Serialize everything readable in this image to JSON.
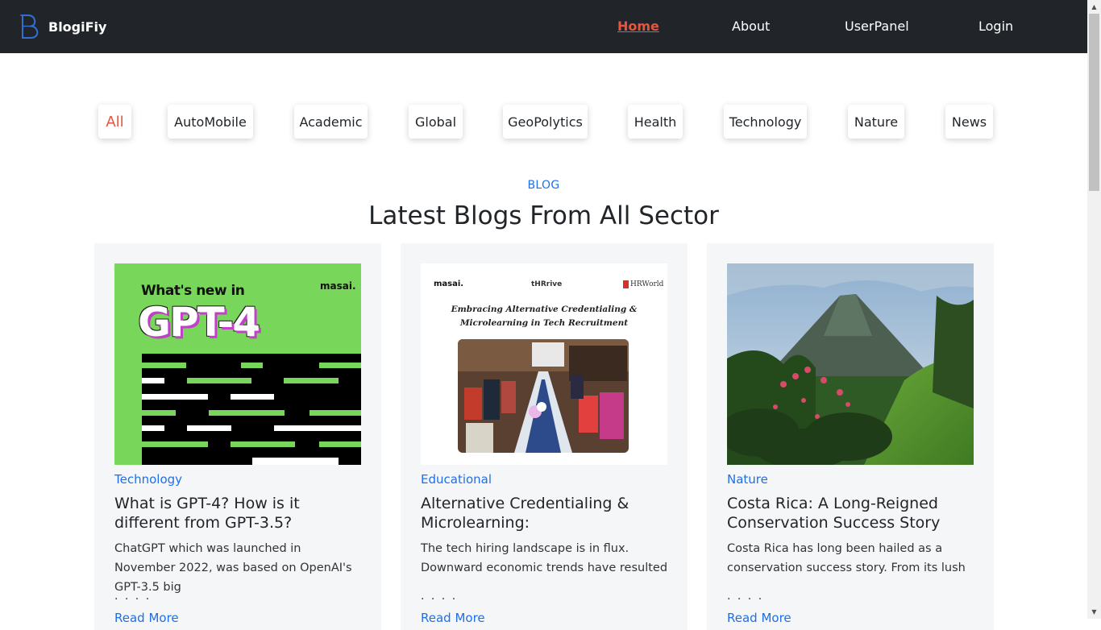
{
  "brand": {
    "name": "BlogiFiy",
    "logo_letter": "B"
  },
  "nav": {
    "items": [
      {
        "label": "Home",
        "active": true
      },
      {
        "label": "About",
        "active": false
      },
      {
        "label": "UserPanel",
        "active": false
      },
      {
        "label": "Login",
        "active": false
      }
    ]
  },
  "categories": [
    {
      "label": "All",
      "active": true
    },
    {
      "label": "AutoMobile",
      "active": false
    },
    {
      "label": "Academic",
      "active": false
    },
    {
      "label": "Global",
      "active": false
    },
    {
      "label": "GeoPolytics",
      "active": false
    },
    {
      "label": "Health",
      "active": false
    },
    {
      "label": "Technology",
      "active": false
    },
    {
      "label": "Nature",
      "active": false
    },
    {
      "label": "News",
      "active": false
    }
  ],
  "section": {
    "tag": "BLOG",
    "title": "Latest Blogs From All Sector"
  },
  "cards": [
    {
      "category": "Technology",
      "title": "What is GPT-4? How is it different from GPT-3.5?",
      "description": "ChatGPT which was launched in November 2022, was based on OpenAI's GPT-3.5 big",
      "dots": ". . . .",
      "more": "Read More",
      "image": {
        "headline": "What's new in",
        "big": "GPT-4",
        "brand": "masai."
      }
    },
    {
      "category": "Educational",
      "title": "Alternative Credentialing & Microlearning:",
      "description": "The tech hiring landscape is in flux. Downward economic trends have resulted",
      "dots": ". . . .",
      "more": "Read More",
      "image": {
        "logo_left": "masai.",
        "logo_center": "tHRrive",
        "logo_right": "HRWorld",
        "headline_1": "Embracing Alternative Credentialing &",
        "headline_2": "Microlearning in Tech Recruitment"
      }
    },
    {
      "category": "Nature",
      "title": "Costa Rica: A Long-Reigned Conservation Success Story",
      "description": "Costa Rica has long been hailed as a conservation success story. From its lush",
      "dots": ". . . .",
      "more": "Read More",
      "image": {}
    }
  ],
  "colors": {
    "navbar_bg": "#212529",
    "accent_active": "#e8543d",
    "link_blue": "#1f6feb",
    "card_bg": "#f5f6f8"
  }
}
